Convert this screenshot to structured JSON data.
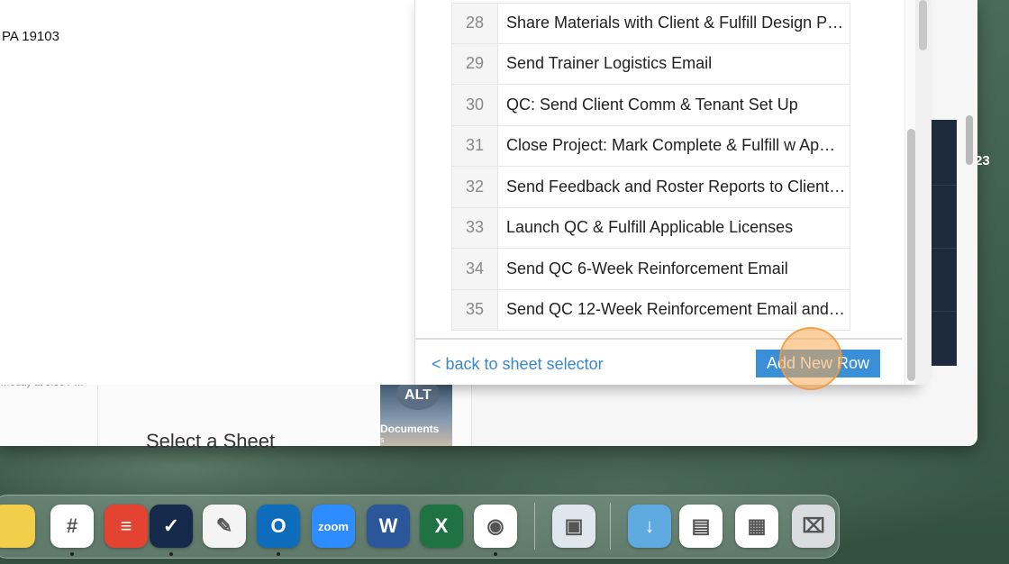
{
  "address": {
    "text": "PA 19103"
  },
  "back_window": {
    "caption": "…oday at 3:36 P…",
    "select_sheet_title": "Select a Sheet",
    "side_number": "23",
    "alt_tile": {
      "badge": "ALT",
      "label": "Documents",
      "sub": "s"
    }
  },
  "rows": [
    {
      "num": "28",
      "text": "Share Materials with Client & Fulfill Design P…"
    },
    {
      "num": "29",
      "text": "Send Trainer Logistics Email"
    },
    {
      "num": "30",
      "text": "QC: Send Client Comm & Tenant Set Up"
    },
    {
      "num": "31",
      "text": "Close Project: Mark Complete & Fulfill w Ap…"
    },
    {
      "num": "32",
      "text": "Send Feedback and Roster Reports to Client…"
    },
    {
      "num": "33",
      "text": "Launch QC & Fulfill Applicable Licenses"
    },
    {
      "num": "34",
      "text": "Send QC 6-Week Reinforcement Email"
    },
    {
      "num": "35",
      "text": "Send QC 12-Week Reinforcement Email and…"
    }
  ],
  "footer": {
    "back_link": "< back to sheet selector",
    "add_button": "Add New Row"
  },
  "dock": {
    "apps": [
      {
        "name": "Stickies",
        "icon": "notes-icon",
        "color": "#f2cf4a"
      },
      {
        "name": "Slack",
        "icon": "slack-icon",
        "color": "#ffffff"
      },
      {
        "name": "Todoist",
        "icon": "todoist-icon",
        "color": "#e44332"
      },
      {
        "name": "Smartsheet",
        "icon": "smartsheet-icon",
        "color": "#15294b"
      },
      {
        "name": "TextEdit",
        "icon": "textedit-icon",
        "color": "#f4f4f4"
      },
      {
        "name": "Outlook",
        "icon": "outlook-icon",
        "color": "#0f6cbd"
      },
      {
        "name": "Zoom",
        "icon": "zoom-icon",
        "color": "#2d8cff",
        "label": "zoom"
      },
      {
        "name": "Word",
        "icon": "word-icon",
        "color": "#2b579a"
      },
      {
        "name": "Excel",
        "icon": "excel-icon",
        "color": "#1f7244"
      },
      {
        "name": "Chrome",
        "icon": "chrome-icon",
        "color": "#ffffff"
      },
      {
        "name": "Preview",
        "icon": "preview-icon",
        "color": "#dfe6ee"
      },
      {
        "name": "Downloads",
        "icon": "downloads-folder-icon",
        "color": "#5ea9e0"
      },
      {
        "name": "Recent 1",
        "icon": "document-thumbnail-icon",
        "color": "#ffffff"
      },
      {
        "name": "Recent 2",
        "icon": "spreadsheet-thumbnail-icon",
        "color": "#ffffff"
      },
      {
        "name": "Trash",
        "icon": "trash-icon",
        "color": "#d9dde0"
      }
    ]
  }
}
